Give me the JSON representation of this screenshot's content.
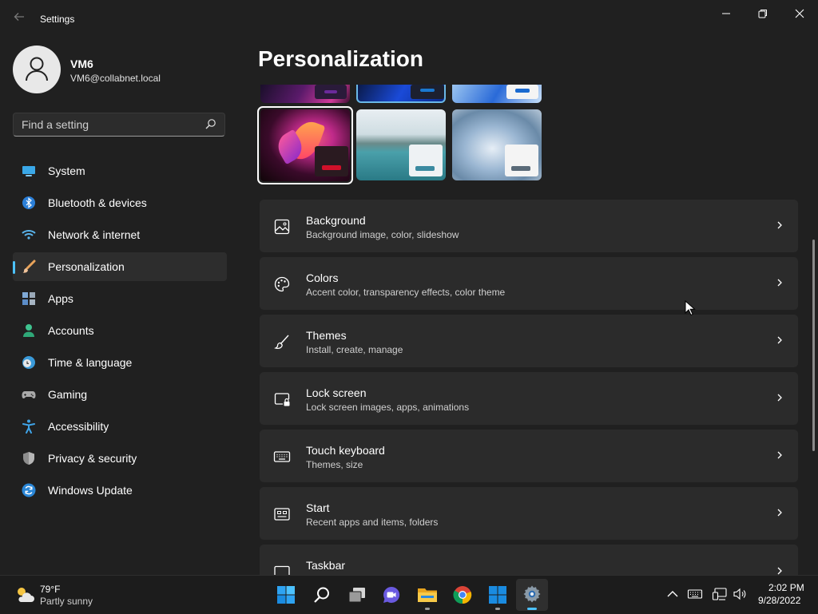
{
  "window": {
    "title": "Settings",
    "back_icon": "back-arrow-icon",
    "controls": [
      "minimize-icon",
      "restore-icon",
      "close-icon"
    ]
  },
  "user": {
    "name": "VM6",
    "email": "VM6@collabnet.local"
  },
  "search": {
    "placeholder": "Find a setting",
    "icon": "search-icon"
  },
  "sidebar": {
    "items": [
      {
        "label": "System",
        "icon": "system-display-icon",
        "active": false
      },
      {
        "label": "Bluetooth & devices",
        "icon": "bluetooth-icon",
        "active": false
      },
      {
        "label": "Network & internet",
        "icon": "wifi-icon",
        "active": false
      },
      {
        "label": "Personalization",
        "icon": "paintbrush-icon",
        "active": true
      },
      {
        "label": "Apps",
        "icon": "apps-icon",
        "active": false
      },
      {
        "label": "Accounts",
        "icon": "accounts-icon",
        "active": false
      },
      {
        "label": "Time & language",
        "icon": "time-language-icon",
        "active": false
      },
      {
        "label": "Gaming",
        "icon": "gamepad-icon",
        "active": false
      },
      {
        "label": "Accessibility",
        "icon": "accessibility-icon",
        "active": false
      },
      {
        "label": "Privacy & security",
        "icon": "shield-icon",
        "active": false
      },
      {
        "label": "Windows Update",
        "icon": "windows-update-icon",
        "active": false
      }
    ],
    "accent_color": "#4cc2ff"
  },
  "main": {
    "title": "Personalization",
    "themes": [
      {
        "name": "glow-dark",
        "selected": false
      },
      {
        "name": "bloom-dark-blue",
        "selected": false
      },
      {
        "name": "bloom-light",
        "selected": false
      },
      {
        "name": "captured-motion",
        "selected": true
      },
      {
        "name": "lake",
        "selected": false
      },
      {
        "name": "flow",
        "selected": false
      }
    ],
    "cards": [
      {
        "title": "Background",
        "subtitle": "Background image, color, slideshow",
        "icon": "image-icon"
      },
      {
        "title": "Colors",
        "subtitle": "Accent color, transparency effects, color theme",
        "icon": "palette-icon"
      },
      {
        "title": "Themes",
        "subtitle": "Install, create, manage",
        "icon": "brush-icon"
      },
      {
        "title": "Lock screen",
        "subtitle": "Lock screen images, apps, animations",
        "icon": "lock-screen-icon"
      },
      {
        "title": "Touch keyboard",
        "subtitle": "Themes, size",
        "icon": "keyboard-icon"
      },
      {
        "title": "Start",
        "subtitle": "Recent apps and items, folders",
        "icon": "start-menu-icon"
      },
      {
        "title": "Taskbar",
        "subtitle": "",
        "icon": "taskbar-icon"
      }
    ]
  },
  "taskbar": {
    "weather": {
      "temp": "79°F",
      "desc": "Partly sunny",
      "icon": "partly-sunny-icon"
    },
    "apps": [
      "start-icon",
      "search-icon",
      "task-view-icon",
      "chat-icon",
      "file-explorer-icon",
      "chrome-icon",
      "windows-app-icon",
      "settings-gear-icon"
    ],
    "tray": [
      "chevron-up-icon",
      "keyboard-layout-icon",
      "network-icon",
      "volume-icon"
    ],
    "time": "2:02 PM",
    "date": "9/28/2022"
  }
}
